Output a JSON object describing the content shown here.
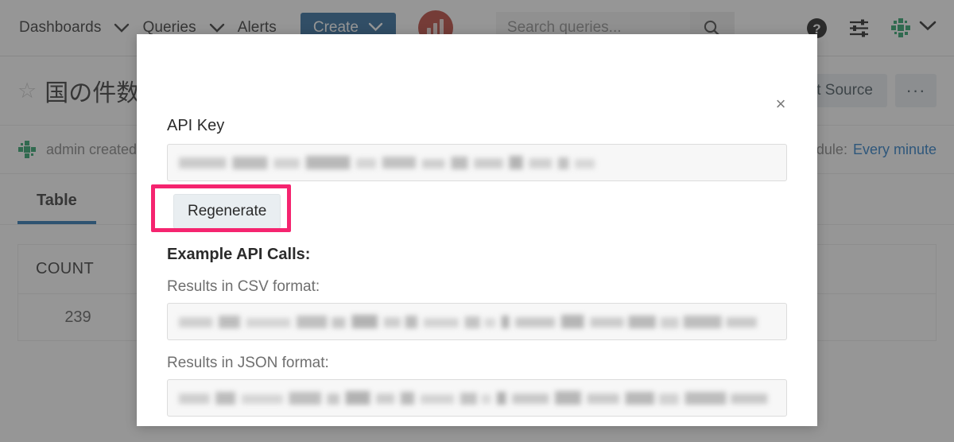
{
  "navbar": {
    "items": [
      {
        "label": "Dashboards",
        "caret": true
      },
      {
        "label": "Queries",
        "caret": true
      },
      {
        "label": "Alerts",
        "caret": false
      }
    ],
    "create_label": "Create",
    "logo_icon": "bar-chart-logo-icon",
    "search": {
      "placeholder": "Search queries...",
      "value": "",
      "search_icon": "search-icon"
    },
    "help_icon": "help-circle-icon",
    "settings_icon": "sliders-settings-icon",
    "avatar_icon": "user-identicon-avatar",
    "avatar_caret_icon": "chevron-down-icon",
    "create_caret_icon": "chevron-down-icon"
  },
  "page": {
    "star_icon": "star-outline-icon",
    "title": "国の件数",
    "edit_source_label": "Edit Source",
    "more_label": "···",
    "meta_avatar_icon": "user-identicon-avatar",
    "meta_text": "admin created",
    "refresh_label": "Refresh Schedule:",
    "refresh_value": "Every minute",
    "tabs": [
      {
        "label": "Table",
        "active": true
      }
    ],
    "table": {
      "columns": [
        "COUNT"
      ],
      "rows": [
        [
          "239"
        ]
      ]
    }
  },
  "modal": {
    "close_icon": "close-x-icon",
    "close_label": "×",
    "api_key_label": "API Key",
    "api_key_value": "",
    "api_key_redacted": true,
    "regenerate_label": "Regenerate",
    "example_calls_title": "Example API Calls:",
    "csv_label": "Results in CSV format:",
    "csv_value": "",
    "csv_redacted": true,
    "json_label": "Results in JSON format:",
    "json_value": "",
    "json_redacted": true
  },
  "annotation": {
    "target": "regenerate-button",
    "color": "#f5246f"
  },
  "colors": {
    "accent_blue": "#1f6094",
    "link_blue": "#1a73c4",
    "logo_red": "#b5382e",
    "avatar_green": "#1e9e63",
    "highlight_pink": "#f5246f",
    "overlay": "rgba(64,64,64,0.55)"
  }
}
